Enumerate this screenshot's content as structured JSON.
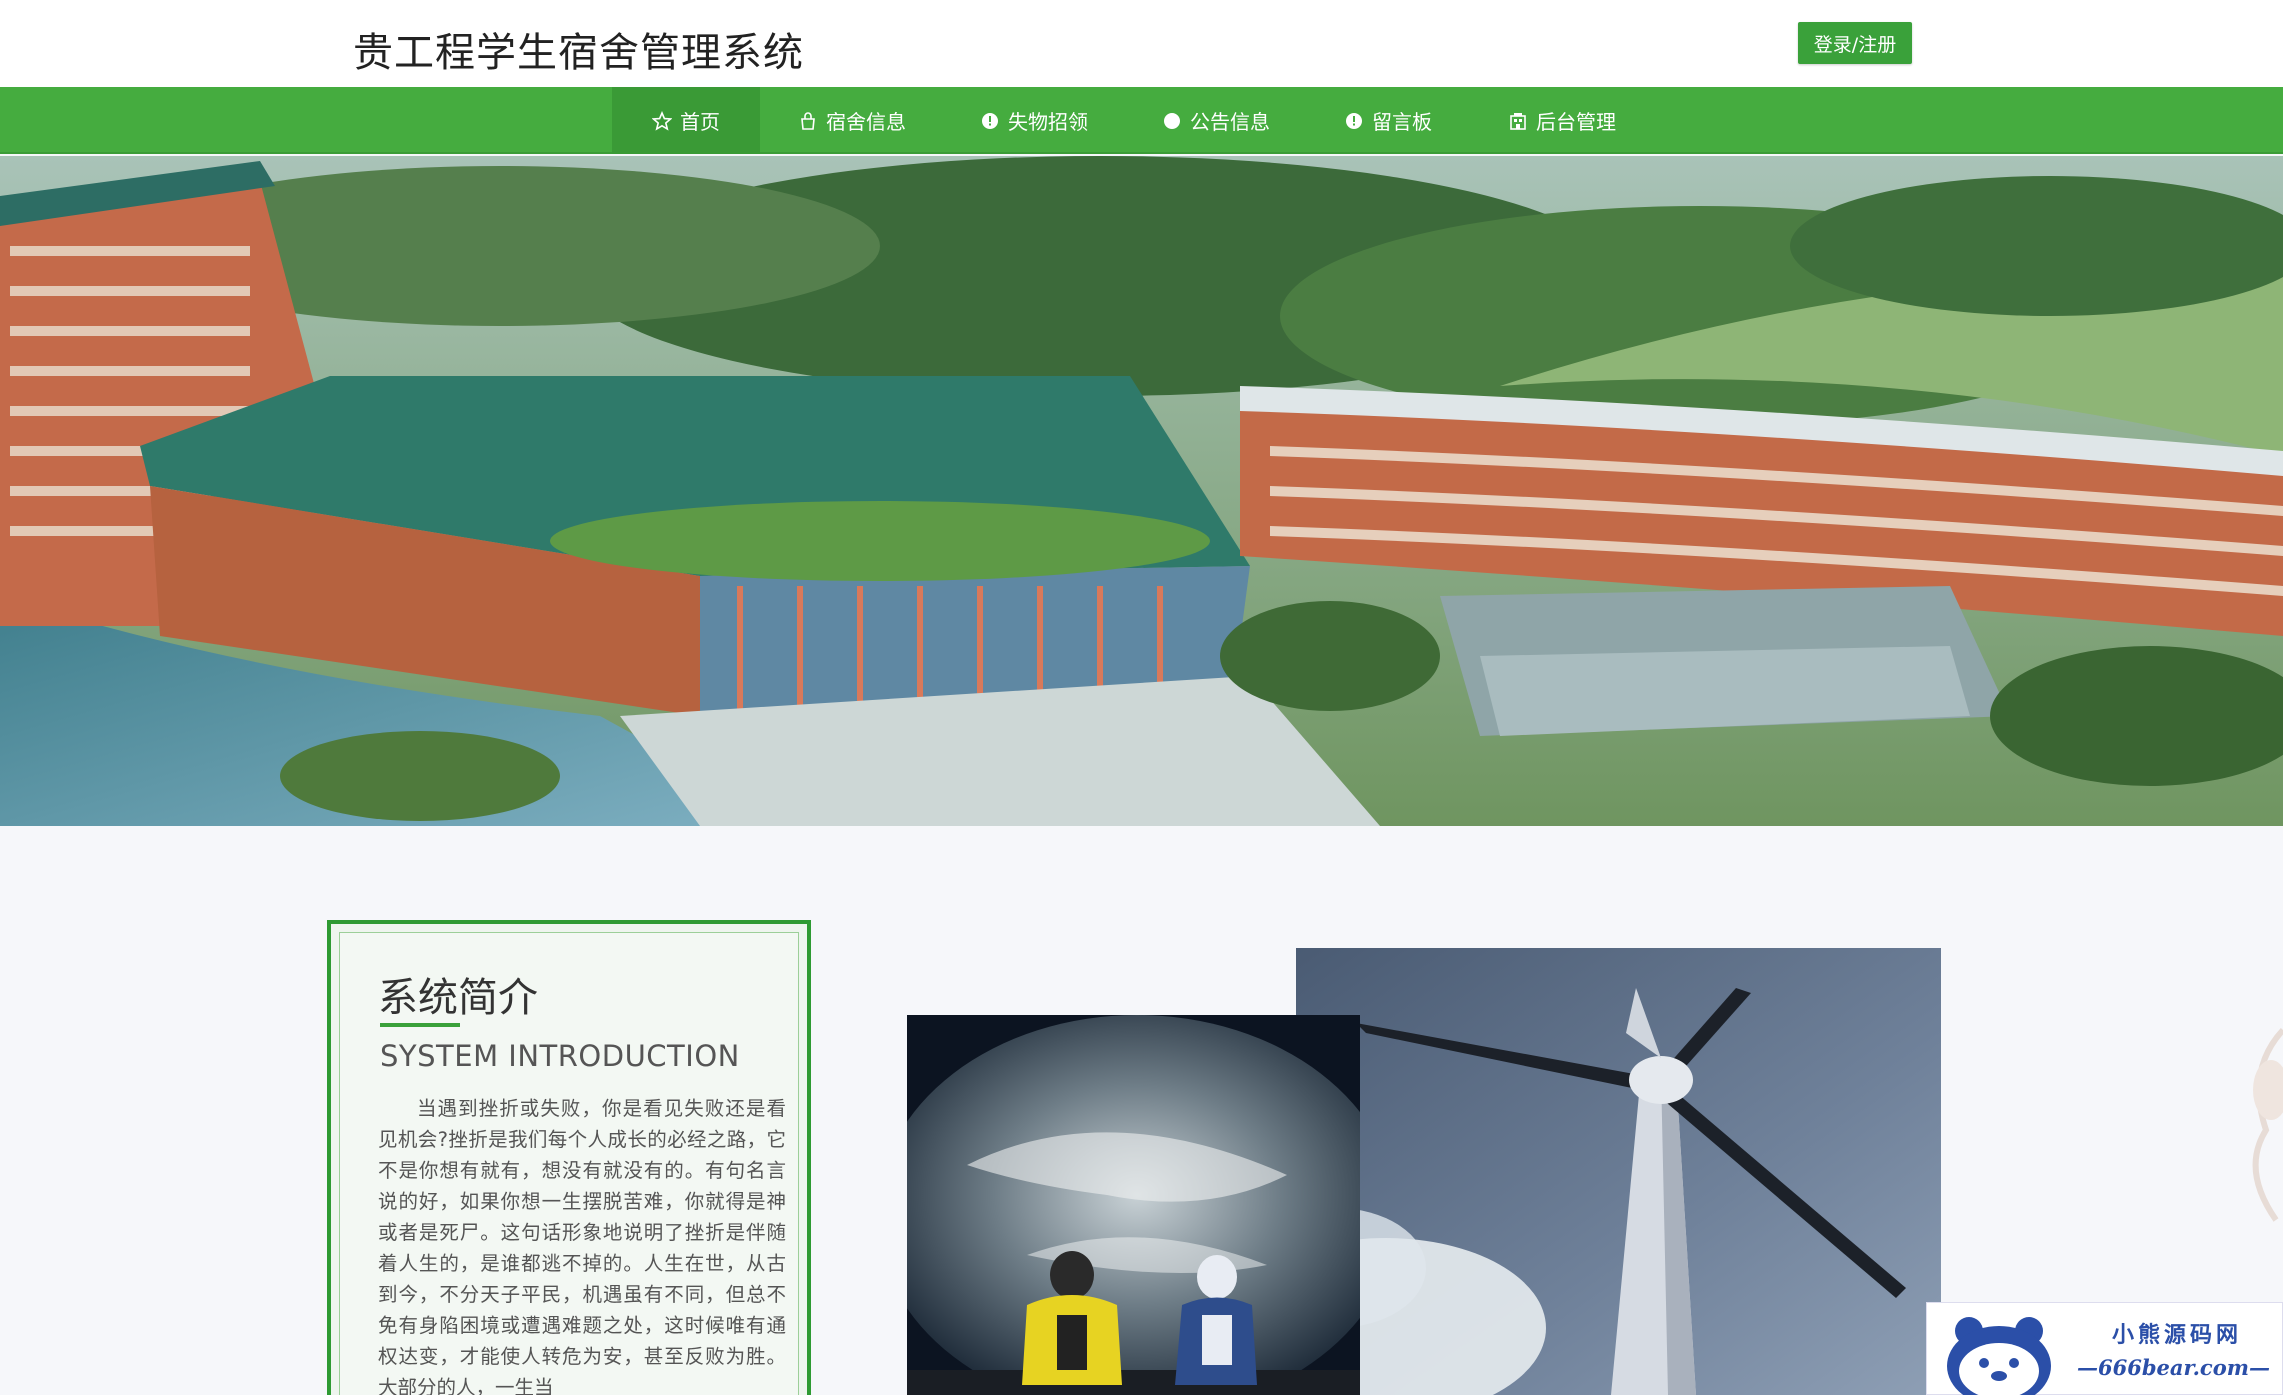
{
  "header": {
    "title": "贵工程学生宿舍管理系统",
    "login_label": "登录/注册"
  },
  "nav": {
    "items": [
      {
        "label": "首页",
        "icon": "star-icon",
        "active": true
      },
      {
        "label": "宿舍信息",
        "icon": "bag-icon",
        "active": false
      },
      {
        "label": "失物招领",
        "icon": "info-circle-icon",
        "active": false
      },
      {
        "label": "公告信息",
        "icon": "circle-icon",
        "active": false
      },
      {
        "label": "留言板",
        "icon": "info-circle-icon",
        "active": false
      },
      {
        "label": "后台管理",
        "icon": "building-icon",
        "active": false
      }
    ]
  },
  "intro": {
    "title": "系统简介",
    "subtitle": "SYSTEM INTRODUCTION",
    "text": "当遇到挫折或失败，你是看见失败还是看见机会?挫折是我们每个人成长的必经之路，它不是你想有就有，想没有就没有的。有句名言说的好，如果你想一生摆脱苦难，你就得是神或者是死尸。这句话形象地说明了挫折是伴随着人生的，是谁都逃不掉的。人生在世，从古到今，不分天子平民，机遇虽有不同，但总不免有身陷困境或遭遇难题之处，这时候唯有通权达变，才能使人转危为安，甚至反败为胜。大部分的人，一生当"
  },
  "watermark": {
    "line1": "小熊源码网",
    "line2": "—666bear.com—"
  },
  "colors": {
    "nav_green": "#45ac3f",
    "accent_green": "#3aa13a"
  }
}
